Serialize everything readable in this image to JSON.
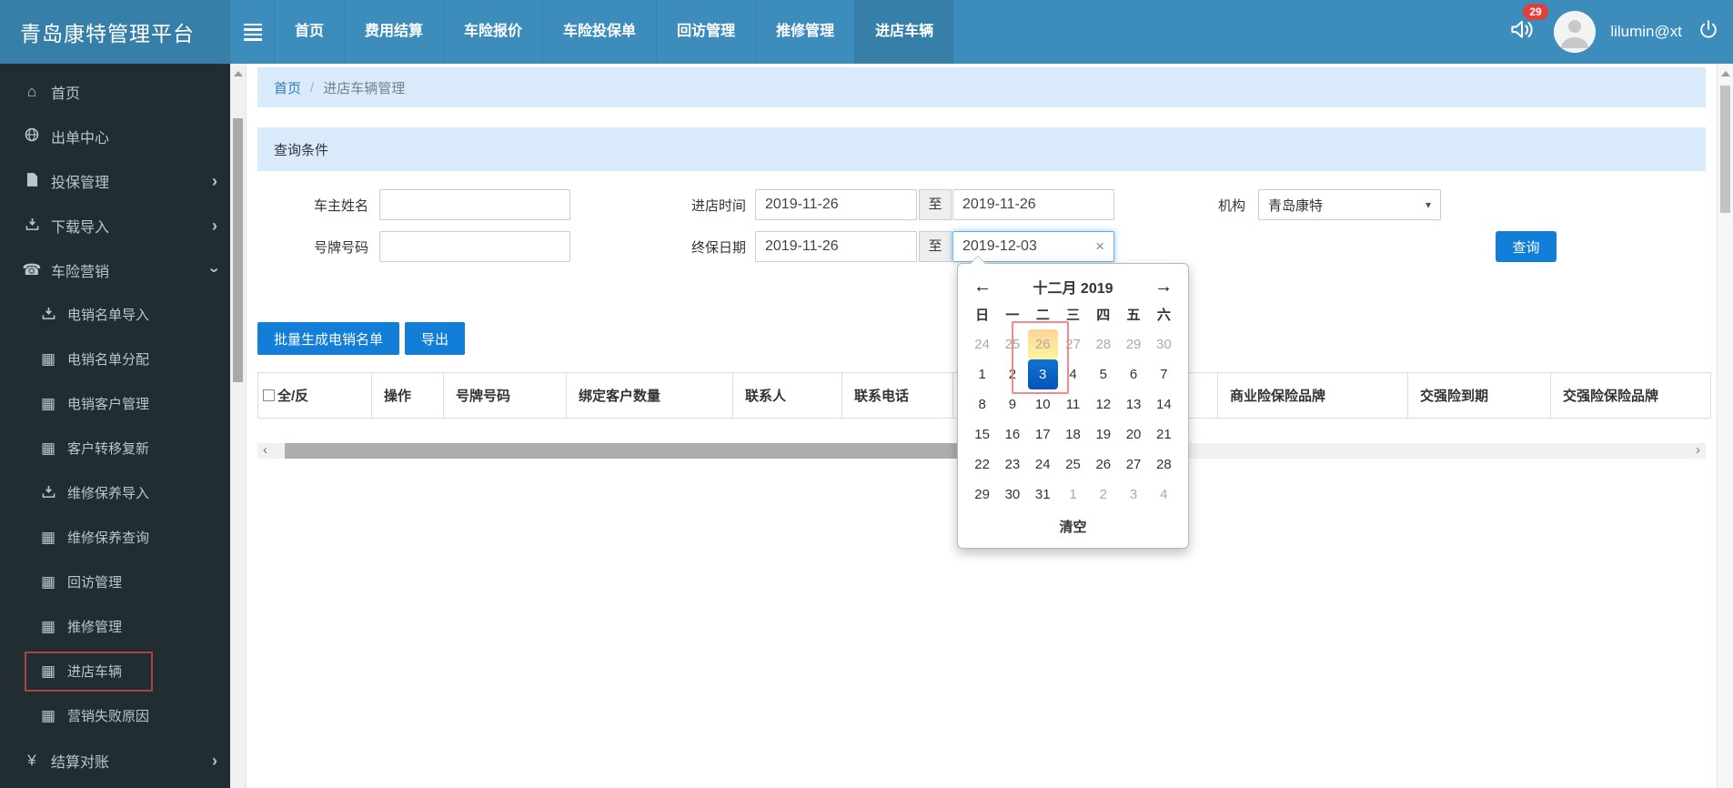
{
  "colors": {
    "topbar": "#3c8dbc",
    "topbar_active": "#367fa9",
    "sidebar": "#222d32",
    "sidebar_text": "#b8c7ce",
    "primary_button": "#137ed8",
    "badge_red": "#e33d3d",
    "panel_header_blue": "#d9eafb",
    "link_blue": "#337ab7",
    "annotation_red_sidebar": "#a94442",
    "annotation_red_calendar": "#f28a8a",
    "calendar_today_bg": "#fdd49a",
    "calendar_selected_bg": "#0f74d2"
  },
  "topbar": {
    "logo": "青岛康特管理平台",
    "user": "lilumin@xt",
    "badge": "29"
  },
  "topnav": {
    "items": [
      {
        "label": "首页"
      },
      {
        "label": "费用结算"
      },
      {
        "label": "车险报价"
      },
      {
        "label": "车险投保单"
      },
      {
        "label": "回访管理"
      },
      {
        "label": "推修管理"
      },
      {
        "label": "进店车辆",
        "active": true
      }
    ]
  },
  "sidebar": {
    "items": [
      {
        "icon": "home-icon",
        "label": "首页"
      },
      {
        "icon": "globe-icon",
        "label": "出单中心"
      },
      {
        "icon": "file-icon",
        "label": "投保管理",
        "chevron": "right"
      },
      {
        "icon": "download-icon",
        "label": "下载导入",
        "chevron": "right"
      },
      {
        "icon": "phone-icon",
        "label": "车险营销",
        "chevron": "down"
      },
      {
        "icon": "download-icon",
        "label": "电销名单导入",
        "sub": true
      },
      {
        "icon": "grid-icon",
        "label": "电销名单分配",
        "sub": true
      },
      {
        "icon": "grid-icon",
        "label": "电销客户管理",
        "sub": true
      },
      {
        "icon": "grid-icon",
        "label": "客户转移复新",
        "sub": true
      },
      {
        "icon": "download-icon",
        "label": "维修保养导入",
        "sub": true
      },
      {
        "icon": "grid-icon",
        "label": "维修保养查询",
        "sub": true
      },
      {
        "icon": "grid-icon",
        "label": "回访管理",
        "sub": true
      },
      {
        "icon": "grid-icon",
        "label": "推修管理",
        "sub": true
      },
      {
        "icon": "grid-icon",
        "label": "进店车辆",
        "sub": true,
        "highlighted": true
      },
      {
        "icon": "grid-icon",
        "label": "营销失败原因",
        "sub": true
      },
      {
        "icon": "yen-icon",
        "label": "结算对账",
        "chevron": "right"
      }
    ]
  },
  "breadcrumb": {
    "home": "首页",
    "separator": "/",
    "current": "进店车辆管理"
  },
  "query": {
    "title": "查询条件",
    "owner_label": "车主姓名",
    "plate_label": "号牌号码",
    "entry_label": "进店时间",
    "end_label": "终保日期",
    "to": "至",
    "org_label": "机构",
    "org_value": "青岛康特",
    "entry_from": "2019-11-26",
    "entry_to": "2019-11-26",
    "end_from": "2019-11-26",
    "end_to": "2019-12-03",
    "search": "查询"
  },
  "actions": {
    "batch": "批量生成电销名单",
    "export": "导出"
  },
  "table": {
    "columns": [
      {
        "label": "全/反",
        "checkbox": true
      },
      {
        "label": "操作"
      },
      {
        "label": "号牌号码"
      },
      {
        "label": "绑定客户数量"
      },
      {
        "label": "联系人"
      },
      {
        "label": "联系电话"
      },
      {
        "label": ""
      },
      {
        "label": "商业险保险品牌"
      },
      {
        "label": "交强险到期"
      },
      {
        "label": "交强险保险品牌"
      }
    ]
  },
  "datepicker": {
    "title": "十二月 2019",
    "weekdays": [
      "日",
      "一",
      "二",
      "三",
      "四",
      "五",
      "六"
    ],
    "weeks": [
      [
        {
          "d": "24",
          "muted": true
        },
        {
          "d": "25",
          "muted": true
        },
        {
          "d": "26",
          "muted": true,
          "today": true
        },
        {
          "d": "27",
          "muted": true
        },
        {
          "d": "28",
          "muted": true
        },
        {
          "d": "29",
          "muted": true
        },
        {
          "d": "30",
          "muted": true
        }
      ],
      [
        {
          "d": "1"
        },
        {
          "d": "2"
        },
        {
          "d": "3",
          "active": true
        },
        {
          "d": "4"
        },
        {
          "d": "5"
        },
        {
          "d": "6"
        },
        {
          "d": "7"
        }
      ],
      [
        {
          "d": "8"
        },
        {
          "d": "9"
        },
        {
          "d": "10"
        },
        {
          "d": "11"
        },
        {
          "d": "12"
        },
        {
          "d": "13"
        },
        {
          "d": "14"
        }
      ],
      [
        {
          "d": "15"
        },
        {
          "d": "16"
        },
        {
          "d": "17"
        },
        {
          "d": "18"
        },
        {
          "d": "19"
        },
        {
          "d": "20"
        },
        {
          "d": "21"
        }
      ],
      [
        {
          "d": "22"
        },
        {
          "d": "23"
        },
        {
          "d": "24"
        },
        {
          "d": "25"
        },
        {
          "d": "26"
        },
        {
          "d": "27"
        },
        {
          "d": "28"
        }
      ],
      [
        {
          "d": "29"
        },
        {
          "d": "30"
        },
        {
          "d": "31"
        },
        {
          "d": "1",
          "muted": true
        },
        {
          "d": "2",
          "muted": true
        },
        {
          "d": "3",
          "muted": true
        },
        {
          "d": "4",
          "muted": true
        }
      ]
    ],
    "clear": "清空"
  }
}
